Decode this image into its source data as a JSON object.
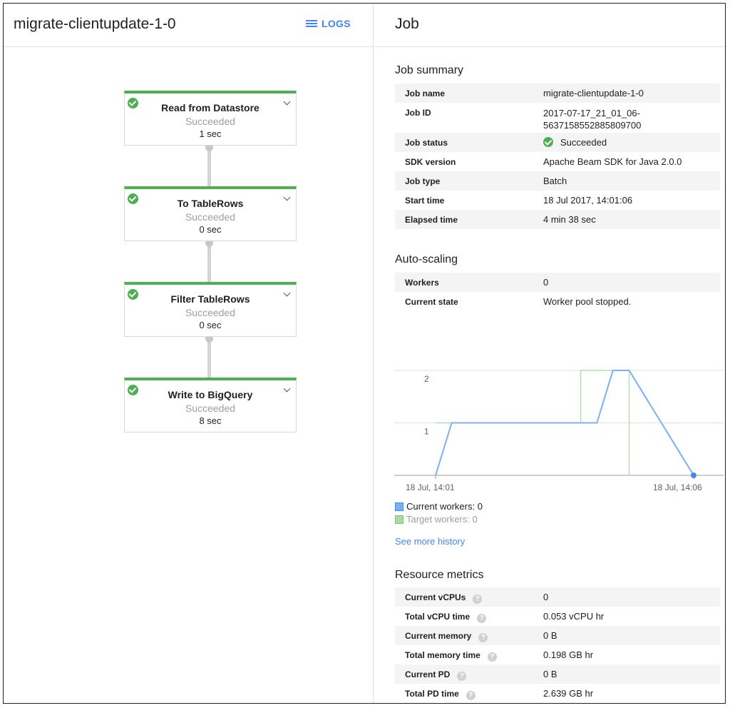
{
  "left": {
    "job_title": "migrate-clientupdate-1-0",
    "logs_label": "LOGS",
    "steps": [
      {
        "name": "Read from Datastore",
        "status": "Succeeded",
        "time": "1 sec"
      },
      {
        "name": "To TableRows",
        "status": "Succeeded",
        "time": "0 sec"
      },
      {
        "name": "Filter TableRows",
        "status": "Succeeded",
        "time": "0 sec"
      },
      {
        "name": "Write to BigQuery",
        "status": "Succeeded",
        "time": "8 sec"
      }
    ]
  },
  "right": {
    "panel_title": "Job",
    "summary": {
      "heading": "Job summary",
      "rows": [
        {
          "label": "Job name",
          "value": "migrate-clientupdate-1-0"
        },
        {
          "label": "Job ID",
          "value": "2017-07-17_21_01_06-",
          "value2": "5637158552885809700"
        },
        {
          "label": "Job status",
          "value": "Succeeded"
        },
        {
          "label": "SDK version",
          "value": "Apache Beam SDK for Java 2.0.0"
        },
        {
          "label": "Job type",
          "value": "Batch"
        },
        {
          "label": "Start time",
          "value": "18 Jul 2017, 14:01:06"
        },
        {
          "label": "Elapsed time",
          "value": "4 min 38 sec"
        }
      ]
    },
    "autoscaling": {
      "heading": "Auto-scaling",
      "rows": [
        {
          "label": "Workers",
          "value": "0"
        },
        {
          "label": "Current state",
          "value": "Worker pool stopped."
        }
      ]
    },
    "legend": {
      "current": "Current workers: 0",
      "target": "Target workers: 0"
    },
    "see_more": "See more history",
    "resources": {
      "heading": "Resource metrics",
      "help_glyph": "?",
      "rows": [
        {
          "label": "Current vCPUs",
          "value": "0"
        },
        {
          "label": "Total vCPU time",
          "value": "0.053 vCPU hr"
        },
        {
          "label": "Current memory",
          "value": "0 B"
        },
        {
          "label": "Total memory time",
          "value": "0.198 GB hr"
        },
        {
          "label": "Current PD",
          "value": "0 B"
        },
        {
          "label": "Total PD time",
          "value": "2.639 GB hr"
        }
      ]
    }
  },
  "colors": {
    "success": "#4caf50",
    "link": "#4285f4",
    "current_series": "#7ab0f5",
    "target_series": "#a8dba0"
  },
  "chart_data": {
    "type": "line",
    "x_tick_labels": [
      "18 Jul, 14:01",
      "18 Jul, 14:06"
    ],
    "y_ticks": [
      1,
      2
    ],
    "ylim": [
      0,
      2
    ],
    "series": [
      {
        "name": "Current workers: 0",
        "x": [
          0,
          0.1,
          1.0,
          1.1,
          1.2,
          1.6
        ],
        "values": [
          0,
          1,
          1,
          2,
          2,
          0
        ]
      },
      {
        "name": "Target workers: 0",
        "x": [
          0,
          0.9,
          0.9,
          1.2,
          1.2
        ],
        "values": [
          1,
          1,
          2,
          2,
          0
        ]
      }
    ]
  }
}
